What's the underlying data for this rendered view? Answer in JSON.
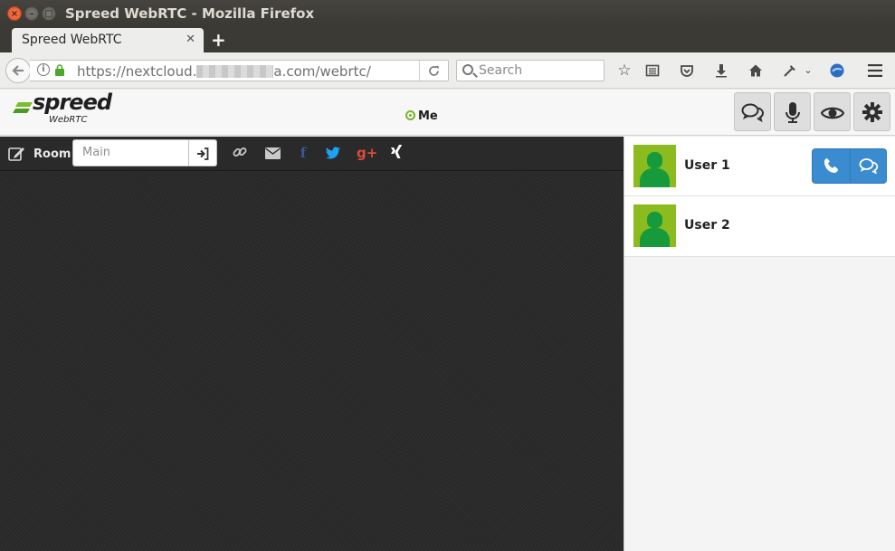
{
  "window": {
    "title": "Spreed WebRTC - Mozilla Firefox",
    "close_glyph": "×",
    "min_glyph": "–",
    "max_glyph": "□"
  },
  "tabs": [
    {
      "label": "Spreed WebRTC",
      "active": true
    }
  ],
  "navbar": {
    "url_prefix": "https://nextcloud.",
    "url_suffix": "a.com/webrtc/",
    "search_placeholder": "Search"
  },
  "header": {
    "logo_word": "spreed",
    "logo_sub": "WebRTC",
    "self_name": "Me",
    "status_color": "#7bb32e"
  },
  "room": {
    "label": "Room",
    "placeholder": "Main"
  },
  "share_icons": [
    {
      "name": "link-icon",
      "color": "#c9c9c9"
    },
    {
      "name": "email-icon",
      "color": "#c9c9c9"
    },
    {
      "name": "facebook-icon",
      "color": "#3b5998"
    },
    {
      "name": "twitter-icon",
      "color": "#1da1f2"
    },
    {
      "name": "google-plus-icon",
      "color": "#dd4b39"
    },
    {
      "name": "xing-icon",
      "color": "#ffffff"
    }
  ],
  "buddies": [
    {
      "name": "User 1",
      "show_actions": true
    },
    {
      "name": "User 2",
      "show_actions": false
    }
  ],
  "colors": {
    "accent": "#3a8bd0",
    "avatar_bg": "#8bbb1e",
    "avatar_fg": "#179a3c",
    "stage_bg": "#2b2b2b"
  }
}
